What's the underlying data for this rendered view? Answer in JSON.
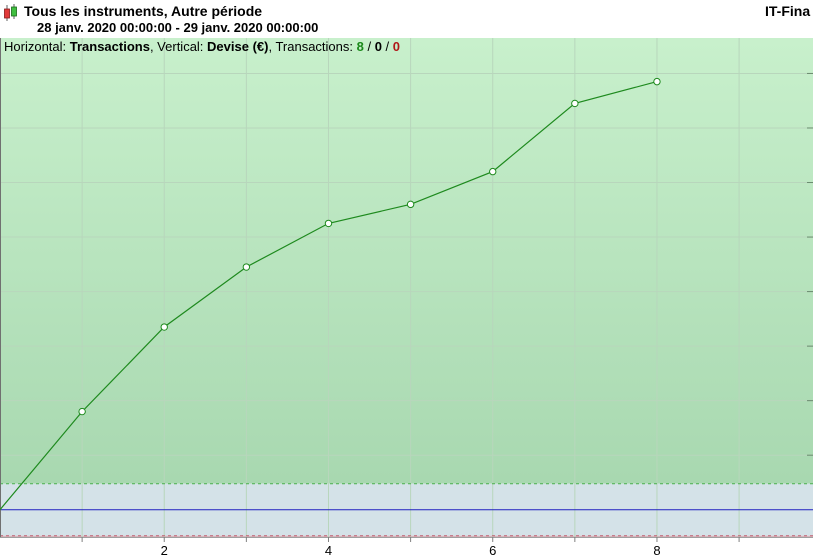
{
  "header": {
    "title": "Tous les instruments, Autre période",
    "period": "28 janv. 2020 00:00:00 - 29 janv. 2020 00:00:00",
    "brand": "IT-Fina"
  },
  "info": {
    "horizontal_label": "Horizontal: ",
    "horizontal_value": "Transactions",
    "vertical_label": ", Vertical: ",
    "vertical_value": "Devise (€)",
    "transactions_label": ", Transactions: ",
    "count_total": "8",
    "sep1": " / ",
    "count_neutral": "0",
    "sep2": " / ",
    "count_losing": "0"
  },
  "colors": {
    "line": "#1e8a1e",
    "gain_zone_top": "#c8f0cc",
    "gain_zone_bottom": "#a8d8b0",
    "zero_line": "#2020c0",
    "loss_zone": "#d8b4bc",
    "neutral_zone": "#d4e2e8"
  },
  "chart_data": {
    "type": "line",
    "x": [
      0,
      1,
      2,
      3,
      4,
      5,
      6,
      7,
      8
    ],
    "series": [
      {
        "values": [
          0,
          36,
          67,
          89,
          105,
          112,
          124,
          149,
          157
        ]
      }
    ],
    "xticks": [
      2,
      4,
      6,
      8
    ],
    "xlim": [
      0,
      9.9
    ],
    "ylim": [
      -10,
      173
    ],
    "grid": true
  }
}
